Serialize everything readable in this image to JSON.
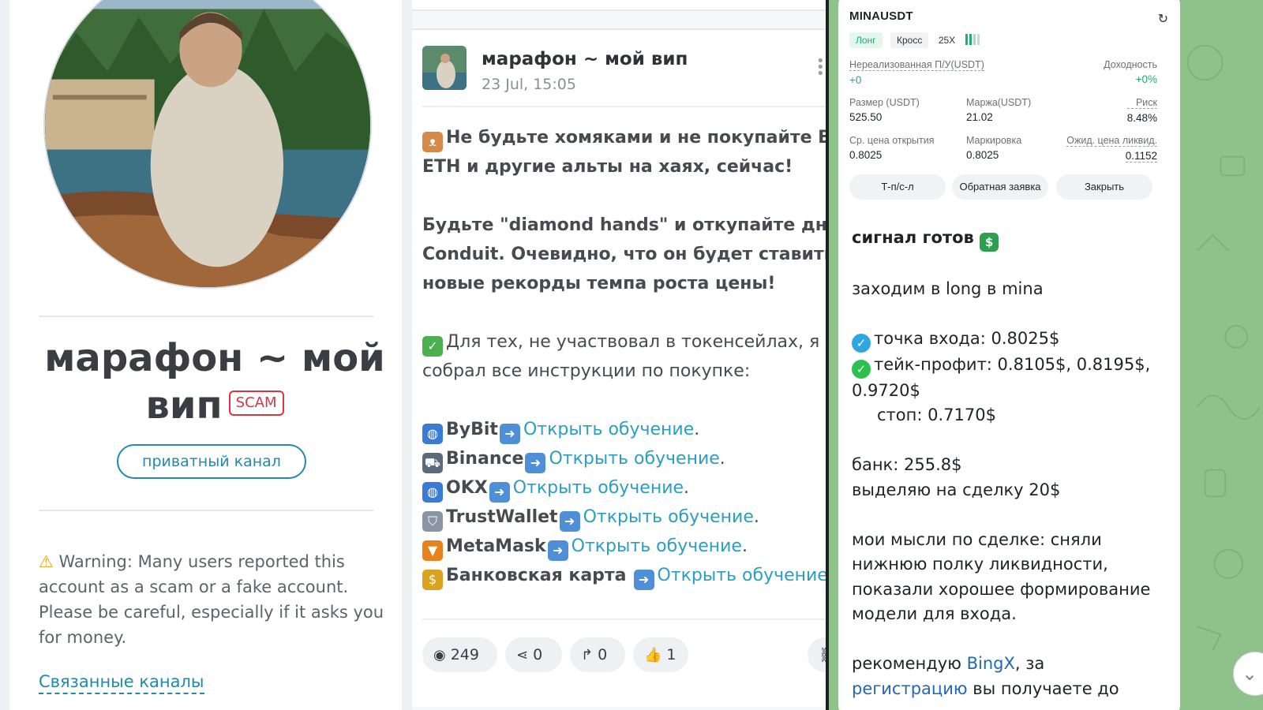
{
  "profile": {
    "title_line1": "марафон ~ мой",
    "title_line2": "вип",
    "scam_badge": "SCAM",
    "private_button": "приватный канал",
    "warning_text": "Warning: Many users reported this account as a scam or a fake account. Please be careful, especially if it asks you for money.",
    "related_link": "Связанные каналы"
  },
  "post": {
    "channel_name": "марафон ~ мой вип",
    "date": "23 Jul, 15:05",
    "line1": "Не будьте хомяками и не покупайте BTC,",
    "line2": "ETH и другие альты на хаях, сейчас!",
    "line3": "Будьте \"diamond hands\" и откупайте дно",
    "line4_link": "Conduit",
    "line4_rest": ". Очевидно, что он будет ставить",
    "line5": "новые рекорды темпа роста цены!",
    "line6": "Для тех, не участвовал в токенсейлах, я",
    "line7": "собрал все инструкции по покупке:",
    "exchanges": [
      {
        "name": "ByBit",
        "link": "Открыть обучение",
        "icon": "globe-icon",
        "color": "#3a7bd5"
      },
      {
        "name": "Binance",
        "link": "Открыть обучение",
        "icon": "cart-icon",
        "color": "#5b6b7a"
      },
      {
        "name": "OKX",
        "link": "Открыть обучение",
        "icon": "globe-icon",
        "color": "#3a7bd5"
      },
      {
        "name": "TrustWallet",
        "link": "Открыть обучение",
        "icon": "shield-icon",
        "color": "#8a95a3"
      },
      {
        "name": "MetaMask",
        "link": "Открыть обучение",
        "icon": "fox-icon",
        "color": "#e8821e"
      },
      {
        "name": "Банковская карта",
        "link": "Открыть обучение",
        "icon": "moneybag-icon",
        "color": "#d9a21f"
      }
    ],
    "stats": {
      "views": "249",
      "shares": "0",
      "forwards": "0",
      "likes": "1"
    }
  },
  "trade": {
    "symbol": "MINAUSDT",
    "tag_long": "Лонг",
    "tag_cross": "Кросс",
    "tag_leverage": "25X",
    "unrealized_label": "Нереализованная П/У(USDT)",
    "unrealized_value": "+0",
    "yield_label": "Доходность",
    "yield_value": "+0%",
    "size_label": "Размер (USDT)",
    "size_value": "525.50",
    "margin_label": "Маржа(USDT)",
    "margin_value": "21.02",
    "risk_label": "Риск",
    "risk_value": "8.48%",
    "open_price_label": "Ср. цена открытия",
    "open_price_value": "0.8025",
    "mark_label": "Маркировка",
    "mark_value": "0.8025",
    "liq_label": "Ожид. цена ликвид.",
    "liq_value": "0.1152",
    "btn_tpsl": "Т-п/с-л",
    "btn_reverse": "Обратная заявка",
    "btn_close": "Закрыть"
  },
  "message": {
    "title": "сигнал готов",
    "line_enter": "заходим в long в mina",
    "entry": "точка входа: 0.8025$",
    "take_profit": "тейк-профит: 0.8105$, 0.8195$,",
    "take_profit_2": "0.9720$",
    "stop": "стоп: 0.7170$",
    "bank": "банк: 255.8$",
    "allocate": "выделяю на сделку 20$",
    "thoughts_1": "мои мысли по сделке: сняли",
    "thoughts_2": "нижнюю полку ликвидности,",
    "thoughts_3": "показали хорошее формирование",
    "thoughts_4": "модели для входа.",
    "recommend_pre": "рекомендую ",
    "recommend_link": "BingX",
    "recommend_post": ", за",
    "reg_link": "регистрацию",
    "reg_post": " вы получаете до"
  },
  "colors": {
    "accent": "#2389a8",
    "scam": "#d9363e",
    "link": "#2a9fc1",
    "tg_bg": "#8fc28a",
    "long_green": "#1fae6f"
  }
}
